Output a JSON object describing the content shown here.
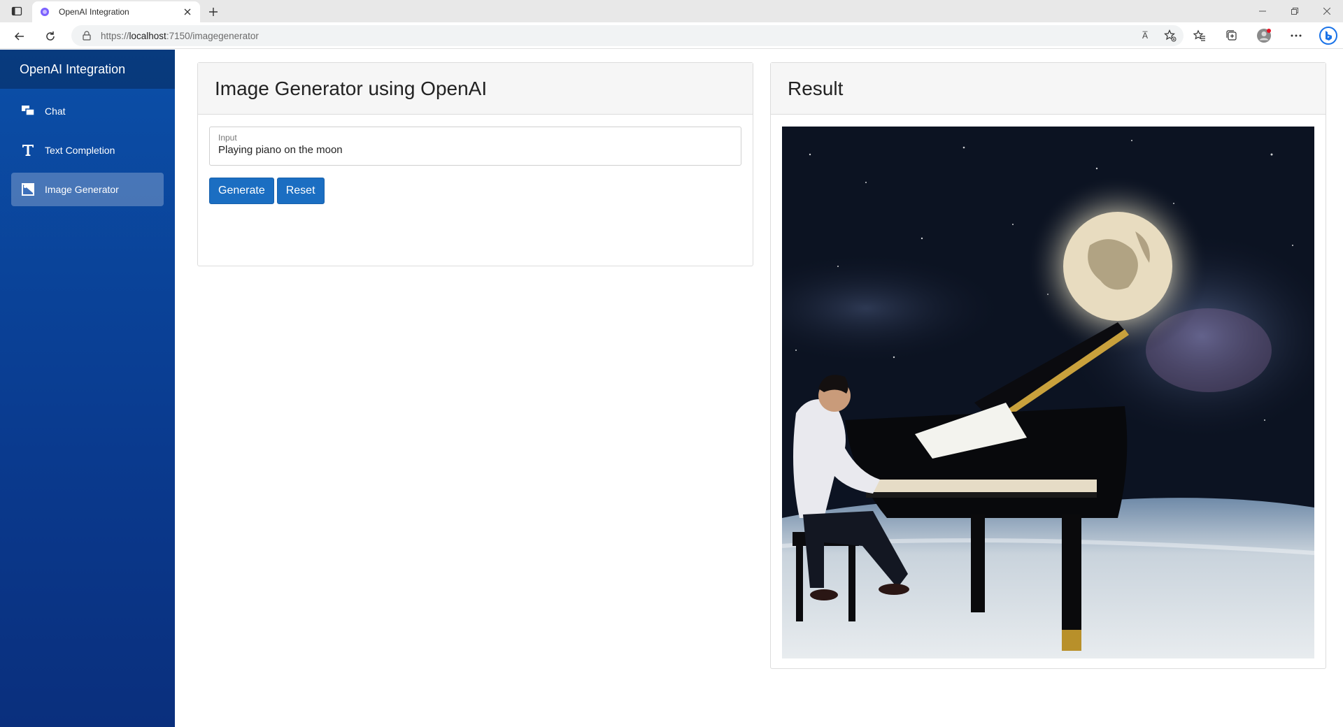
{
  "browser": {
    "tab_title": "OpenAI Integration",
    "url_scheme": "https://",
    "url_host": "localhost",
    "url_path": ":7150/imagegenerator",
    "read_aloud_label": "A̅"
  },
  "sidebar": {
    "brand": "OpenAI Integration",
    "items": [
      {
        "label": "Chat",
        "icon": "chat-icon",
        "active": false
      },
      {
        "label": "Text Completion",
        "icon": "text-icon",
        "active": false
      },
      {
        "label": "Image Generator",
        "icon": "image-icon",
        "active": true
      }
    ]
  },
  "generator": {
    "title": "Image Generator using OpenAI",
    "input_label": "Input",
    "input_value": "Playing piano on the moon",
    "generate_label": "Generate",
    "reset_label": "Reset"
  },
  "result": {
    "title": "Result"
  },
  "colors": {
    "primary_button": "#1b6ec2",
    "sidebar_top": "#0b4fa8",
    "sidebar_bottom": "#0a2f7d"
  }
}
